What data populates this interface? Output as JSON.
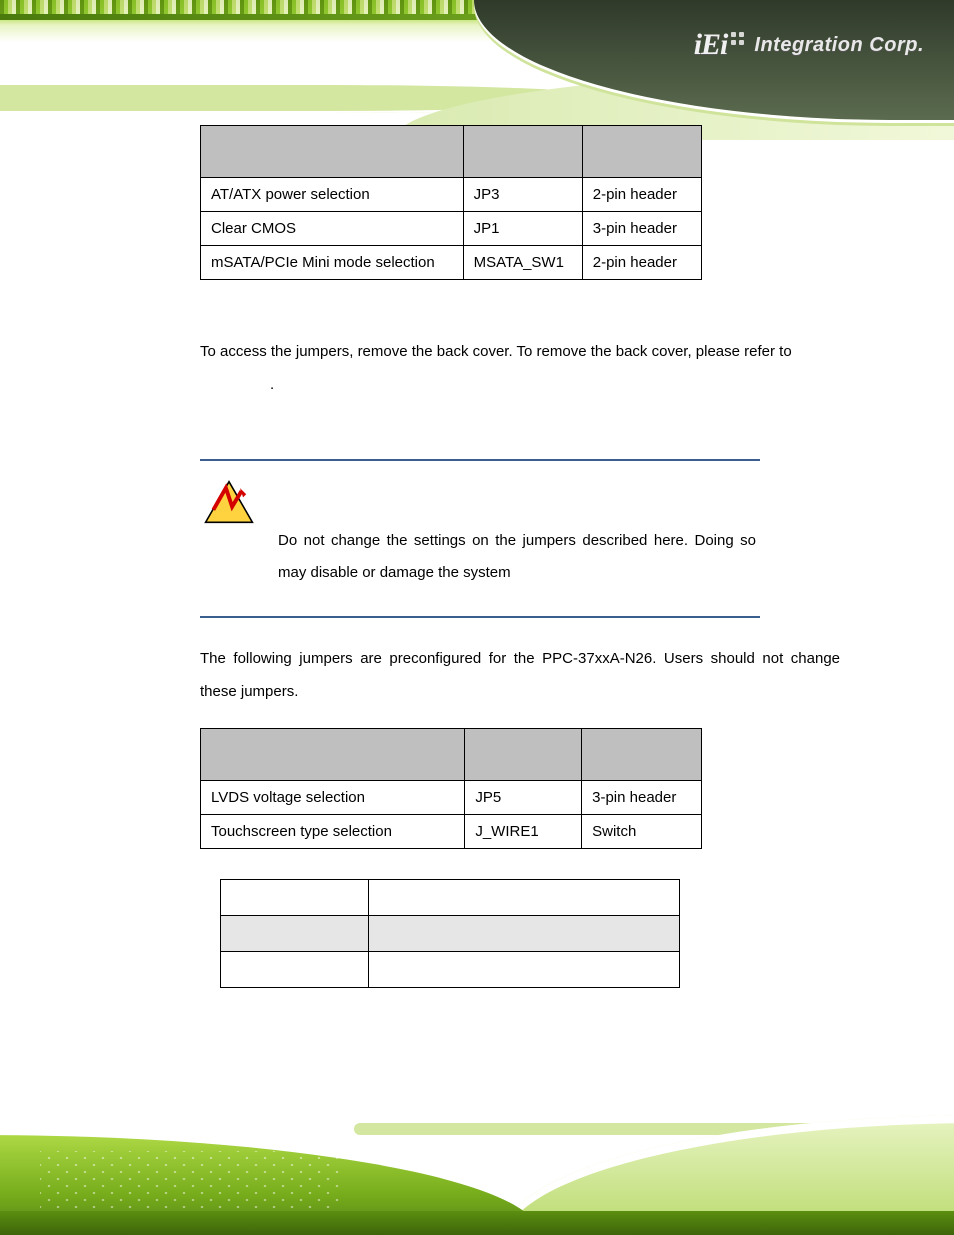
{
  "brand": {
    "logo_text": "iEi",
    "tagline": "Integration Corp."
  },
  "table1": {
    "rows": [
      {
        "desc": "AT/ATX power selection",
        "label": "JP3",
        "type": "2-pin header"
      },
      {
        "desc": "Clear CMOS",
        "label": "JP1",
        "type": "3-pin header"
      },
      {
        "desc": "mSATA/PCIe Mini mode selection",
        "label": "MSATA_SW1",
        "type": "2-pin header"
      }
    ]
  },
  "paragraphs": {
    "access_jumpers_1": "To access the jumpers, remove the back cover. To remove the back cover, please refer to ",
    "access_jumpers_2": ".",
    "warn_text": "Do not change the settings on the jumpers described here. Doing so may disable or damage the system",
    "after_warn": "The following jumpers are preconfigured for the PPC-37xxA-N26. Users should not change these jumpers."
  },
  "table2": {
    "rows": [
      {
        "desc": "LVDS voltage selection",
        "label": "JP5",
        "type": "3-pin header"
      },
      {
        "desc": "Touchscreen type selection",
        "label": "J_WIRE1",
        "type": "Switch"
      }
    ]
  }
}
